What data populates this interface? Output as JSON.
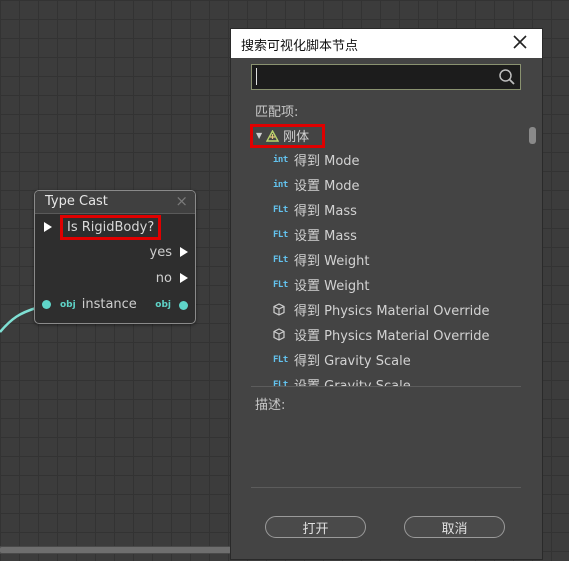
{
  "node": {
    "title": "Type Cast",
    "close_glyph": "×",
    "check_label": "Is RigidBody?",
    "outputs": {
      "yes": "yes",
      "no": "no"
    },
    "instance_label": "instance",
    "obj_tag": "obj",
    "pin_color": "#5fd4c8"
  },
  "dialog": {
    "title": "搜索可视化脚本节点",
    "search": {
      "value": "",
      "placeholder": ""
    },
    "matches_label": "匹配项:",
    "category": {
      "label": "刚体",
      "expanded": true,
      "icon": "rigidbody-icon"
    },
    "items": [
      {
        "type": "int",
        "label": "得到 Mode"
      },
      {
        "type": "int",
        "label": "设置 Mode"
      },
      {
        "type": "flt",
        "label": "得到 Mass"
      },
      {
        "type": "flt",
        "label": "设置 Mass"
      },
      {
        "type": "flt",
        "label": "得到 Weight"
      },
      {
        "type": "flt",
        "label": "设置 Weight"
      },
      {
        "type": "cube",
        "label": "得到 Physics Material Override"
      },
      {
        "type": "cube",
        "label": "设置 Physics Material Override"
      },
      {
        "type": "flt",
        "label": "得到 Gravity Scale"
      },
      {
        "type": "flt",
        "label": "设置 Gravity Scale"
      }
    ],
    "type_tags": {
      "int": "int",
      "flt": "FLt"
    },
    "description_label": "描述:",
    "description": "",
    "buttons": {
      "open": "打开",
      "cancel": "取消"
    }
  },
  "colors": {
    "highlight": "#e00000",
    "accent": "#63c3ef",
    "wire": "#7fe0d4"
  }
}
